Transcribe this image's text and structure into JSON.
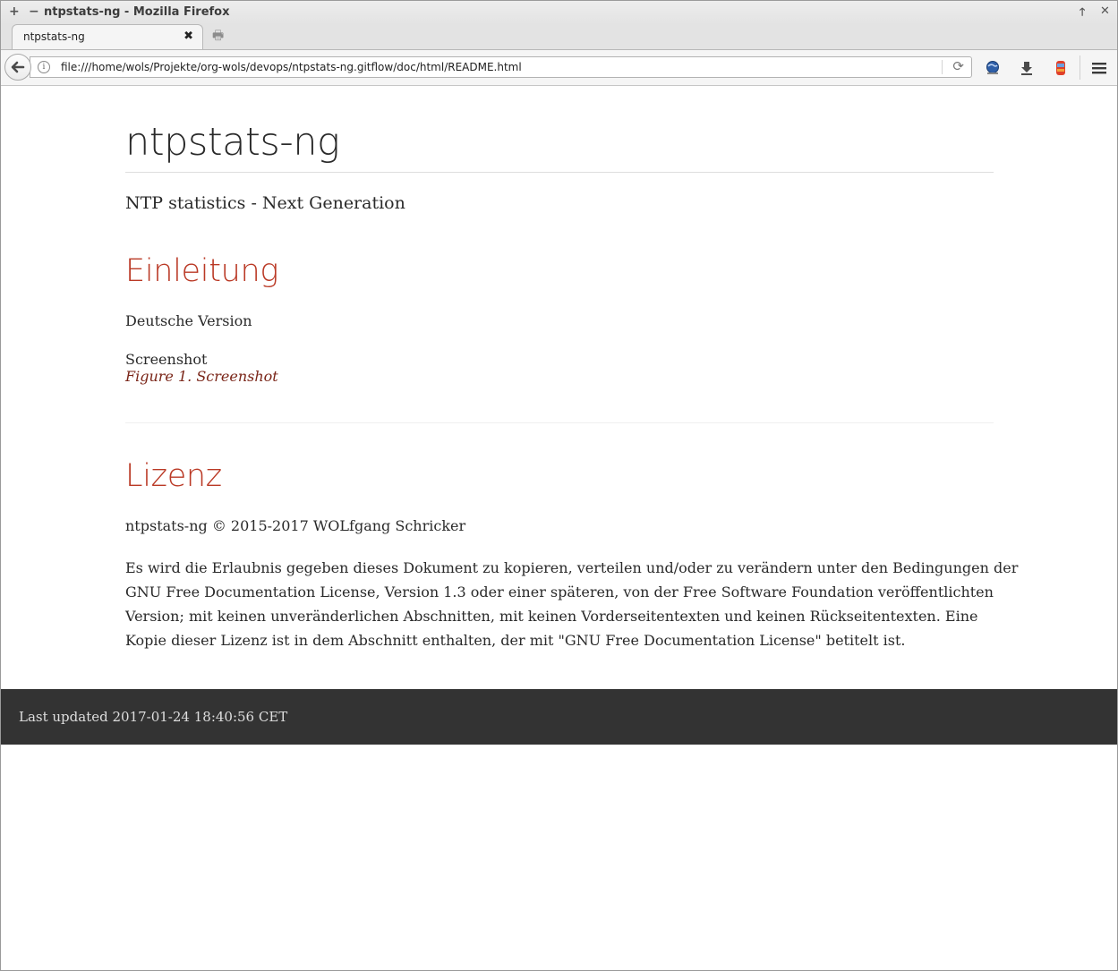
{
  "window": {
    "title": "ntpstats-ng - Mozilla Firefox",
    "plus_glyph": "+",
    "minus_glyph": "−",
    "up_glyph": "🡑",
    "close_glyph": "✕"
  },
  "tabs": [
    {
      "label": "ntpstats-ng",
      "close_glyph": "✖"
    }
  ],
  "newtab_glyph": "🖶",
  "urlbar": {
    "url": "file:///home/wols/Projekte/org-wols/devops/ntpstats-ng.gitflow/doc/html/README.html",
    "info_glyph": "i",
    "reload_glyph": "⟳"
  },
  "toolbar": {
    "menu_glyph": "≡",
    "icons": [
      "back-arrow-icon",
      "site-info-icon",
      "reload-icon",
      "bookmark-globe-icon",
      "download-icon",
      "addon-icon",
      "hamburger-menu-icon"
    ]
  },
  "doc": {
    "title": "ntpstats-ng",
    "subtitle": "NTP statistics - Next Generation",
    "sections": [
      {
        "heading": "Einleitung",
        "paragraphs": [
          "Deutsche Version"
        ],
        "image_alt": "Screenshot",
        "figure_caption": "Figure 1. Screenshot"
      },
      {
        "heading": "Lizenz",
        "copyright": "ntpstats-ng © 2015-2017 WOLfgang Schricker",
        "license_lines": [
          "Es wird die Erlaubnis gegeben dieses Dokument zu kopieren, verteilen und/oder zu verändern unter den Bedingungen der",
          "GNU Free Documentation License, Version 1.3 oder einer späteren, von der Free Software Foundation veröffentlichten",
          "Version; mit keinen unveränderlichen Abschnitten, mit keinen Vorderseitentexten und keinen Rückseitentexten. Eine",
          "Kopie dieser Lizenz ist in dem Abschnitt enthalten, der mit \"GNU Free Documentation License\" betitelt ist."
        ]
      }
    ]
  },
  "footer": {
    "text": "Last updated 2017-01-24 18:40:56 CET"
  },
  "colors": {
    "heading": "#ba3925",
    "caption": "#7a2518",
    "footer_bg": "#333333",
    "text": "#2a2a2a"
  }
}
